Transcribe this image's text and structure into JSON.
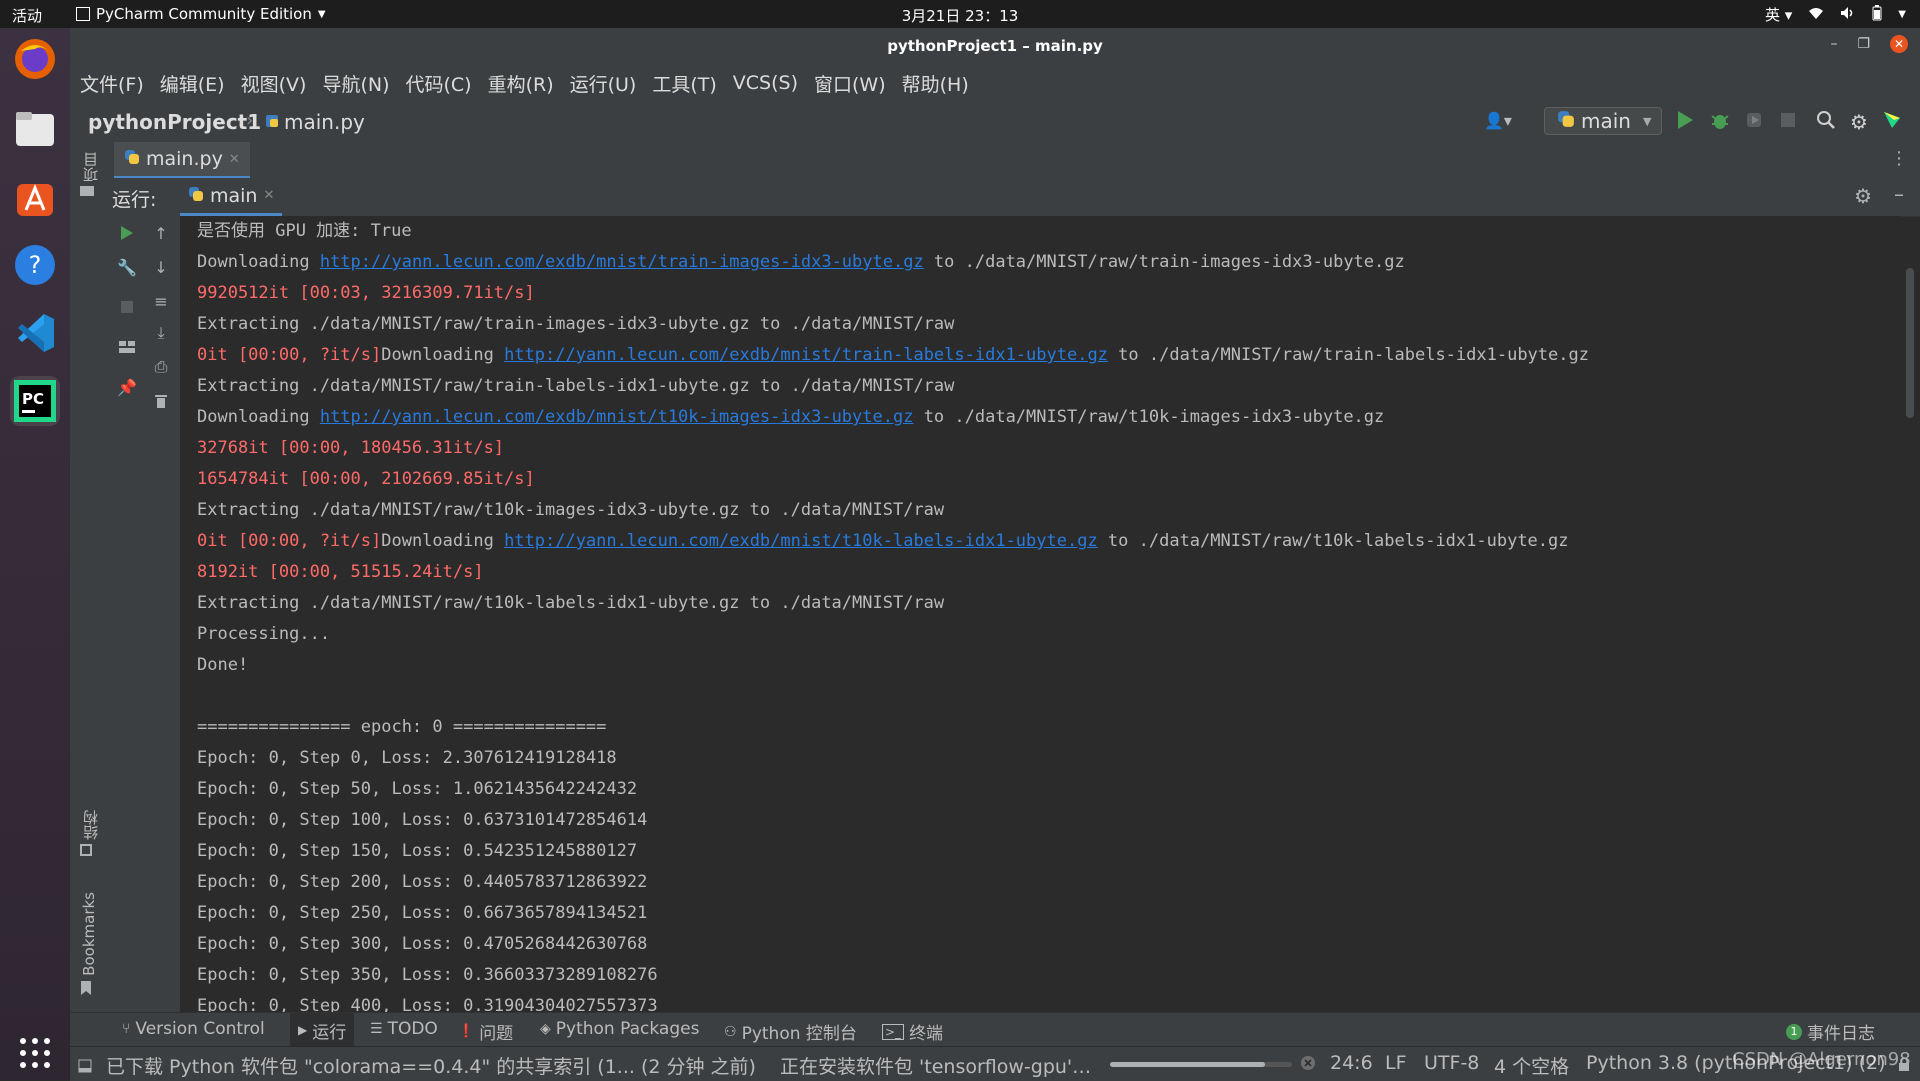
{
  "topbar": {
    "activities": "活动",
    "app_name": "PyCharm Community Edition",
    "clock": "3月21日  23：13",
    "input_method": "英"
  },
  "window": {
    "title": "pythonProject1 – main.py"
  },
  "menu": [
    "文件(F)",
    "编辑(E)",
    "视图(V)",
    "导航(N)",
    "代码(C)",
    "重构(R)",
    "运行(U)",
    "工具(T)",
    "VCS(S)",
    "窗口(W)",
    "帮助(H)"
  ],
  "navbar": {
    "project": "pythonProject1",
    "file": "main.py",
    "run_config": "main"
  },
  "editor_tab": {
    "label": "main.py"
  },
  "left_stripe": {
    "project_label": "项目",
    "structure_label": "结构",
    "bookmarks_label": "Bookmarks"
  },
  "run_panel": {
    "label": "运行:",
    "tab": "main"
  },
  "console": [
    {
      "t": "norm",
      "text": "是否使用 GPU 加速: True"
    },
    {
      "t": "mix",
      "parts": [
        [
          "norm",
          "Downloading "
        ],
        [
          "link",
          "http://yann.lecun.com/exdb/mnist/train-images-idx3-ubyte.gz"
        ],
        [
          "norm",
          " to ./data/MNIST/raw/train-images-idx3-ubyte.gz"
        ]
      ]
    },
    {
      "t": "err",
      "text": "9920512it [00:03, 3216309.71it/s]"
    },
    {
      "t": "norm",
      "text": "Extracting ./data/MNIST/raw/train-images-idx3-ubyte.gz to ./data/MNIST/raw"
    },
    {
      "t": "mix",
      "parts": [
        [
          "err",
          "0it [00:00, ?it/s]"
        ],
        [
          "norm",
          "Downloading "
        ],
        [
          "link",
          "http://yann.lecun.com/exdb/mnist/train-labels-idx1-ubyte.gz"
        ],
        [
          "norm",
          " to ./data/MNIST/raw/train-labels-idx1-ubyte.gz"
        ]
      ]
    },
    {
      "t": "norm",
      "text": "Extracting ./data/MNIST/raw/train-labels-idx1-ubyte.gz to ./data/MNIST/raw"
    },
    {
      "t": "mix",
      "parts": [
        [
          "norm",
          "Downloading "
        ],
        [
          "link",
          "http://yann.lecun.com/exdb/mnist/t10k-images-idx3-ubyte.gz"
        ],
        [
          "norm",
          " to ./data/MNIST/raw/t10k-images-idx3-ubyte.gz"
        ]
      ]
    },
    {
      "t": "err",
      "text": "32768it [00:00, 180456.31it/s]"
    },
    {
      "t": "err",
      "text": "1654784it [00:00, 2102669.85it/s]"
    },
    {
      "t": "norm",
      "text": "Extracting ./data/MNIST/raw/t10k-images-idx3-ubyte.gz to ./data/MNIST/raw"
    },
    {
      "t": "mix",
      "parts": [
        [
          "err",
          "0it [00:00, ?it/s]"
        ],
        [
          "norm",
          "Downloading "
        ],
        [
          "link",
          "http://yann.lecun.com/exdb/mnist/t10k-labels-idx1-ubyte.gz"
        ],
        [
          "norm",
          " to ./data/MNIST/raw/t10k-labels-idx1-ubyte.gz"
        ]
      ]
    },
    {
      "t": "err",
      "text": "8192it [00:00, 51515.24it/s]"
    },
    {
      "t": "norm",
      "text": "Extracting ./data/MNIST/raw/t10k-labels-idx1-ubyte.gz to ./data/MNIST/raw"
    },
    {
      "t": "norm",
      "text": "Processing..."
    },
    {
      "t": "norm",
      "text": "Done!"
    },
    {
      "t": "norm",
      "text": ""
    },
    {
      "t": "norm",
      "text": "=============== epoch: 0 ==============="
    },
    {
      "t": "norm",
      "text": "Epoch: 0, Step 0, Loss: 2.307612419128418"
    },
    {
      "t": "norm",
      "text": "Epoch: 0, Step 50, Loss: 1.0621435642242432"
    },
    {
      "t": "norm",
      "text": "Epoch: 0, Step 100, Loss: 0.6373101472854614"
    },
    {
      "t": "norm",
      "text": "Epoch: 0, Step 150, Loss: 0.542351245880127"
    },
    {
      "t": "norm",
      "text": "Epoch: 0, Step 200, Loss: 0.4405783712863922"
    },
    {
      "t": "norm",
      "text": "Epoch: 0, Step 250, Loss: 0.6673657894134521"
    },
    {
      "t": "norm",
      "text": "Epoch: 0, Step 300, Loss: 0.4705268442630768"
    },
    {
      "t": "norm",
      "text": "Epoch: 0, Step 350, Loss: 0.36603373289108276"
    },
    {
      "t": "norm",
      "text": "Epoch: 0, Step 400, Loss: 0.31904304027557373"
    }
  ],
  "bottom_tabs": {
    "version_control": "Version Control",
    "run": "运行",
    "todo": "TODO",
    "problems": "问题",
    "python_packages": "Python Packages",
    "python_console": "Python 控制台",
    "terminal": "终端",
    "event_log": "事件日志",
    "event_count": "1"
  },
  "status": {
    "message": "已下载 Python 软件包 \"colorama==0.4.4\" 的共享索引 (1... (2 分钟 之前)",
    "installing": "正在安装软件包 'tensorflow-gpu'…",
    "progress": 0.85,
    "position": "24:6",
    "line_sep": "LF",
    "encoding": "UTF-8",
    "indent": "4 个空格",
    "interpreter": "Python 3.8 (pythonProject1) (2)",
    "watermark": "CSDN @Algernon98"
  },
  "colors": {
    "accent": "#4a88c7",
    "run_green": "#499c54",
    "error_red": "#ff6b68",
    "link_blue": "#287bde",
    "close_red": "#e95420"
  }
}
